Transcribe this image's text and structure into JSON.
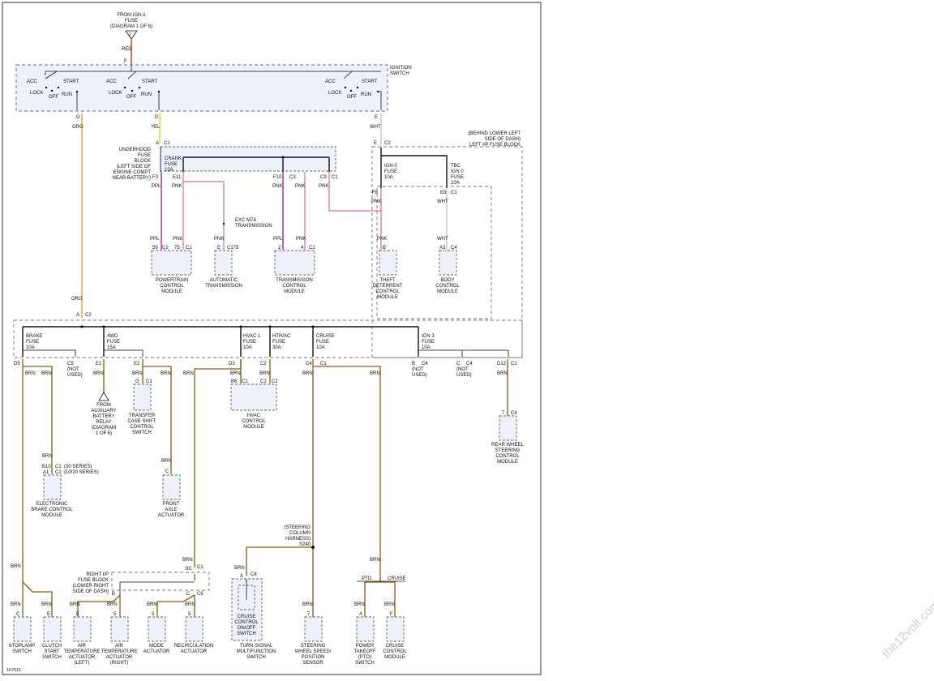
{
  "source": {
    "text": [
      "FROM IGN A",
      "FUSE",
      "(DIAGRAM 1 OF 6)"
    ]
  },
  "ignition_switch": {
    "title": [
      "IGNITION",
      "SWITCH"
    ],
    "acc": "ACC",
    "lock": "LOCK",
    "off": "OFF",
    "start": "START",
    "run": "RUN",
    "pins": {
      "f": "F",
      "g": "G",
      "d": "D",
      "e": "E"
    }
  },
  "wires": {
    "red": "RED",
    "org": "ORG",
    "yel": "YEL",
    "wht": "WHT",
    "ppl": "PPL",
    "pnk": "PNK",
    "brn": "BRN"
  },
  "underhood": {
    "text": [
      "UNDERHOOD",
      "FUSE",
      "BLOCK",
      "(LEFT SIDE OF",
      "ENGINE COMPT",
      "NEAR BATTERY)"
    ],
    "crank_fuse": [
      "CRANK",
      "FUSE",
      "10A"
    ],
    "pins": {
      "a": "A",
      "c1": "C1",
      "f3": "F3",
      "e11": "E11",
      "f10": "F10",
      "c3": "C3",
      "c9": "C9",
      "c1b": "C1"
    }
  },
  "left_ip_block": {
    "text": [
      "(BEHIND LOWER LEFT",
      "SIDE OF DASH)",
      "LEFT I/P FUSE BLOCK"
    ],
    "ign0_fuse": [
      "IGN 0",
      "FUSE",
      "10A"
    ],
    "tbc_fuse": [
      "TBC",
      "IGN 0",
      "FUSE",
      "10A"
    ],
    "pins": {
      "e": "E",
      "c2": "C2",
      "f8": "F8",
      "e8": "E8",
      "c1": "C1"
    }
  },
  "exc_note": [
    "EXC M74",
    "TRANSMISSION"
  ],
  "modules_top": [
    {
      "label": [
        "POWERTRAIN",
        "CONTROL",
        "MODULE"
      ],
      "pins": [
        "59",
        "C2",
        "75",
        "C1"
      ]
    },
    {
      "label": [
        "AUTOMATIC",
        "TRANSMISSION"
      ],
      "pins": [
        "E",
        "C175"
      ]
    },
    {
      "label": [
        "TRANSMISSION",
        "CONTROL",
        "MODULE"
      ],
      "pins": [
        "2",
        "4",
        "C1"
      ]
    },
    {
      "label": [
        "THEFT",
        "DETERRENT",
        "CONTROL",
        "MODULE"
      ],
      "pins": [
        "B"
      ]
    },
    {
      "label": [
        "BODY",
        "CONTROL",
        "MODULE"
      ],
      "pins": [
        "A3",
        "C4"
      ]
    }
  ],
  "bus_connector": {
    "a": "A",
    "c2": "C2"
  },
  "fuses_lower": [
    {
      "label": [
        "BRAKE",
        "FUSE",
        "10A"
      ]
    },
    {
      "label": [
        "4WD",
        "FUSE",
        "15A"
      ]
    },
    {
      "label": [
        "HVAC 1",
        "FUSE",
        "10A"
      ]
    },
    {
      "label": [
        "HTR/AC",
        "FUSE",
        "30A"
      ]
    },
    {
      "label": [
        "CRUISE",
        "FUSE",
        "10A"
      ]
    },
    {
      "label": [
        "IGN 3",
        "FUSE",
        "10A"
      ]
    }
  ],
  "lower_pins": {
    "d5": "D5",
    "c5": "C5",
    "not_used": [
      "(NOT",
      "USED)"
    ],
    "e1": "E1",
    "e2": "E2",
    "d3": "D3",
    "c2": "C2",
    "c4": "C4",
    "c1": "C1",
    "b": "B",
    "c4b": "C4",
    "c": "C",
    "d12": "D12"
  },
  "aux_battery": [
    "FROM",
    "AUXILIARY",
    "BATTERY",
    "RELAY",
    "(DIAGRAM",
    "1 OF 6)"
  ],
  "modules_mid": [
    {
      "label": [
        "TRANSFER",
        "CASE SHIFT",
        "CONTROL",
        "SWITCH"
      ],
      "pins": [
        "G",
        "C1"
      ]
    },
    {
      "label": [
        "HVAC",
        "CONTROL",
        "MODULE"
      ],
      "pins": [
        "B6",
        "C1",
        "C2",
        "C2"
      ]
    },
    {
      "label": [
        "REAR WHEEL",
        "STEERING",
        "CONTROL",
        "MODULE"
      ],
      "pins": [
        "7",
        "C4"
      ]
    },
    {
      "label": [
        "ELECTRONIC",
        "BRAKE CONTROL",
        "MODULE"
      ],
      "pins": [
        "B10",
        "A1",
        "C2",
        "C2"
      ],
      "notes": [
        "(30 SERIES)",
        "(10/20 SERIES)"
      ]
    },
    {
      "label": [
        "FRONT",
        "AXLE",
        "ACTUATOR"
      ],
      "pins": [
        "C"
      ]
    }
  ],
  "steering_harness": [
    "(STEERING",
    "COLUMN",
    "HARNESS)",
    "S240"
  ],
  "right_ip_block": {
    "text": [
      "RIGHT I/P",
      "FUSE BLOCK",
      "(LOWER RIGHT",
      "SIDE OF DASH)"
    ],
    "pins": [
      "8C",
      "C1",
      "B",
      "C",
      "C6"
    ]
  },
  "pto_labels": {
    "pto": "PTO",
    "cruise": "CRUISE"
  },
  "components_bottom": [
    {
      "label": [
        "STOPLAMP",
        "SWITCH"
      ],
      "pin": "C"
    },
    {
      "label": [
        "CLUTCH",
        "START",
        "SWITCH"
      ],
      "pin": "E"
    },
    {
      "label": [
        "AIR",
        "TEMPERATURE",
        "ACTUATOR",
        "(LEFT)"
      ],
      "pin": "5"
    },
    {
      "label": [
        "AIR",
        "TEMPERATURE",
        "ACTUATOR",
        "(RIGHT)"
      ],
      "pin": "5"
    },
    {
      "label": [
        "MODE",
        "ACTUATOR"
      ],
      "pin": "5"
    },
    {
      "label": [
        "RECIRCULATION",
        "ACTUATOR"
      ],
      "pin": "5"
    },
    {
      "label": [
        "CRUISE",
        "CONTROL",
        "ON/OFF",
        "SWITCH"
      ],
      "pin": "A",
      "conn": "C4"
    },
    {
      "label": [
        "TURN SIGNAL",
        "MULTIFUNCTION",
        "SWITCH"
      ],
      "pin": ""
    },
    {
      "label": [
        "STEERING",
        "WHEEL SPEED/",
        "POSITION",
        "SENSOR"
      ],
      "pin": "7"
    },
    {
      "label": [
        "POWER",
        "TAKEOFF",
        "(PTO)",
        "SWITCH"
      ],
      "pin": "A"
    },
    {
      "label": [
        "CRUISE",
        "CONTROL",
        "MODULE"
      ],
      "pin": "F"
    }
  ],
  "diagram_id": "167511",
  "watermark": "the12volt.com"
}
